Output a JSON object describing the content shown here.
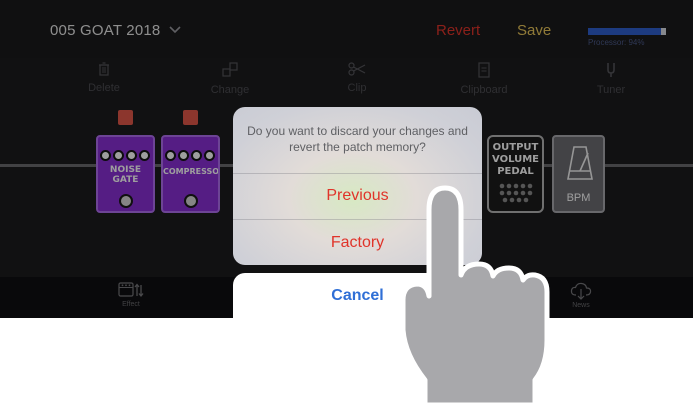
{
  "topbar": {
    "patch_name": "005 GOAT 2018",
    "revert_label": "Revert",
    "save_label": "Save",
    "processor_label": "Processor: 94%",
    "processor_usage": 0.94
  },
  "toolbar": {
    "items": [
      {
        "label": "Delete",
        "icon": "trash-icon"
      },
      {
        "label": "Change",
        "icon": "change-icon"
      },
      {
        "label": "Clip",
        "icon": "scissors-icon"
      },
      {
        "label": "Clipboard",
        "icon": "clipboard-icon"
      },
      {
        "label": "Tuner",
        "icon": "tuning-fork-icon"
      }
    ]
  },
  "pedals": [
    {
      "name_line1": "NOISE",
      "name_line2": "GATE",
      "led_on": true
    },
    {
      "name_line1": "COMPRESSOR",
      "led_on": true
    },
    {
      "name_line1": "OUTPUT",
      "name_line2": "VOLUME",
      "name_line3": "PEDAL"
    },
    {
      "name_line1": "BPM"
    }
  ],
  "tabbar": {
    "effect_label": "Effect",
    "news_label": "News"
  },
  "dialog": {
    "message": "Do you want to discard your changes and revert the patch memory?",
    "option_previous": "Previous",
    "option_factory": "Factory",
    "cancel_label": "Cancel"
  },
  "colors": {
    "destructive": "#e0342a",
    "accent_blue": "#2f6fd6",
    "save_gold": "#e9c65a",
    "pedal_purple": "#8a2fd6"
  }
}
